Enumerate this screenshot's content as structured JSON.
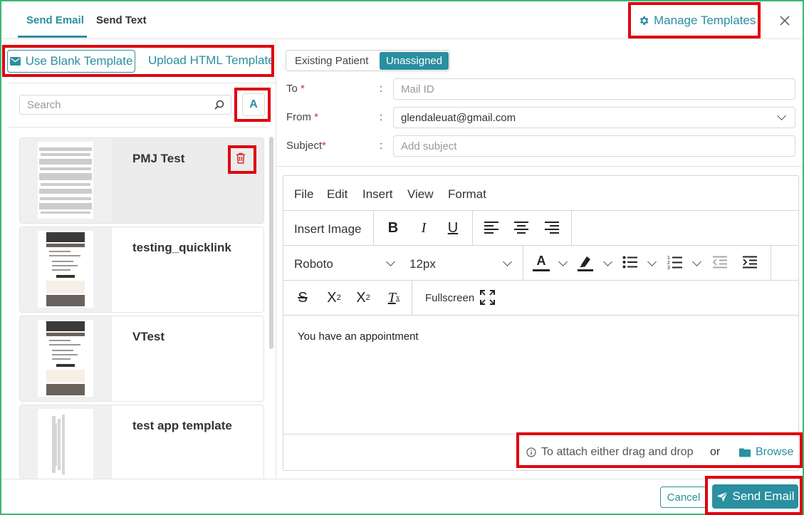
{
  "tabs": [
    {
      "label": "Send Email",
      "active": true
    },
    {
      "label": "Send Text",
      "active": false
    }
  ],
  "header": {
    "manage_templates_label": "Manage Templates"
  },
  "template_panel": {
    "use_blank_label": "Use Blank Template",
    "upload_html_label": "Upload HTML Template",
    "search_placeholder": "Search",
    "sort_button_label": "A",
    "templates": [
      {
        "name": "PMJ Test",
        "selected": true
      },
      {
        "name": "testing_quicklink",
        "selected": false
      },
      {
        "name": "VTest",
        "selected": false
      },
      {
        "name": "test app template",
        "selected": false
      }
    ]
  },
  "recipient": {
    "segments": [
      "Existing Patient",
      "Unassigned"
    ],
    "active_segment": "Unassigned"
  },
  "form": {
    "to_label": "To",
    "to_placeholder": "Mail ID",
    "from_label": "From",
    "from_value": "glendaleuat@gmail.com",
    "subject_label": "Subject",
    "subject_placeholder": "Add subject",
    "separator": ":"
  },
  "editor": {
    "menu": [
      "File",
      "Edit",
      "Insert",
      "View",
      "Format"
    ],
    "insert_image_label": "Insert Image",
    "font_family": "Roboto",
    "font_size": "12px",
    "fullscreen_label": "Fullscreen",
    "body_text": "You have an appointment"
  },
  "attachment": {
    "hint_text": "To attach either drag and drop",
    "or_text": "or",
    "browse_label": "Browse"
  },
  "footer": {
    "cancel_label": "Cancel",
    "send_label": "Send Email"
  },
  "colors": {
    "accent": "#2a8f9f",
    "highlight_box": "#e0000e",
    "frame": "#3cb878",
    "danger": "#d32f2f"
  }
}
